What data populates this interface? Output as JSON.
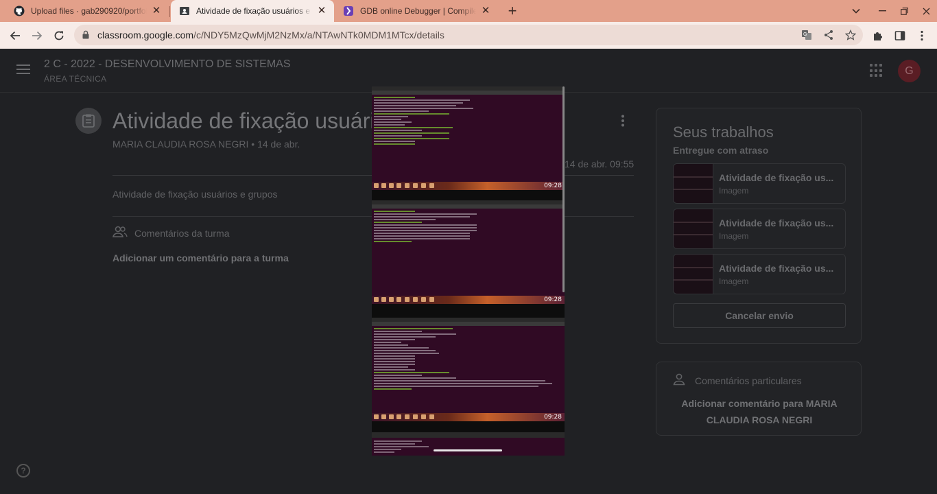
{
  "browser": {
    "tabs": [
      {
        "title": "Upload files · gab290920/portfolio",
        "icon": "github-icon",
        "active": false
      },
      {
        "title": "Atividade de fixação usuários e grupos",
        "icon": "classroom-icon",
        "active": true
      },
      {
        "title": "GDB online Debugger | Compiler",
        "icon": "gdb-icon",
        "active": false
      }
    ],
    "url_host": "classroom.google.com",
    "url_path": "/c/NDY5MzQwMjM2NzMx/a/NTAwNTk0MDM1MTcx/details"
  },
  "classroom": {
    "class_name": "2 C - 2022 - DESENVOLVIMENTO DE SISTEMAS",
    "class_section": "ÁREA TÉCNICA",
    "avatar_letter": "G",
    "avatar_color": "#5a1d24"
  },
  "assignment": {
    "title": "Atividade de fixação usuários e grupos",
    "author_line": "MARIA CLAUDIA ROSA NEGRI • 14 de abr.",
    "edited_date": "14 de abr. 09:55",
    "description": "Atividade de fixação usuários e grupos",
    "class_comments_label": "Comentários da turma",
    "add_class_comment": "Adicionar um comentário para a turma"
  },
  "your_work": {
    "title": "Seus trabalhos",
    "status": "Entregue com atraso",
    "attachments": [
      {
        "name": "Atividade de fixação us...",
        "type": "Imagem"
      },
      {
        "name": "Atividade de fixação us...",
        "type": "Imagem"
      },
      {
        "name": "Atividade de fixação us...",
        "type": "Imagem"
      }
    ],
    "unsubmit_label": "Cancelar envio"
  },
  "private_comments": {
    "label": "Comentários particulares",
    "add_label": "Adicionar comentário para MARIA CLAUDIA ROSA NEGRI"
  },
  "viewer": {
    "clocks": [
      "09:28",
      "09:28",
      "09:28"
    ]
  },
  "help_label": "?"
}
